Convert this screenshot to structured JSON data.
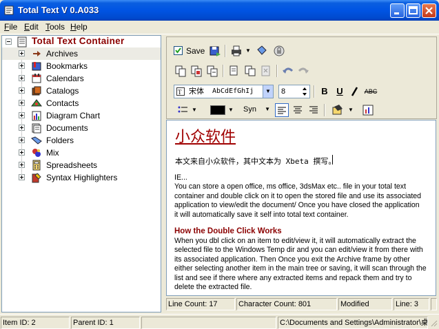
{
  "window": {
    "title": "Total Text V 0.A033"
  },
  "menu": [
    "File",
    "Edit",
    "Tools",
    "Help"
  ],
  "tree": {
    "root": "Total Text Container",
    "items": [
      {
        "label": "Archives",
        "icon": "arrow-icon"
      },
      {
        "label": "Bookmarks",
        "icon": "bookmarks-icon"
      },
      {
        "label": "Calendars",
        "icon": "calendar-icon"
      },
      {
        "label": "Catalogs",
        "icon": "catalog-icon"
      },
      {
        "label": "Contacts",
        "icon": "contacts-icon"
      },
      {
        "label": "Diagram Chart",
        "icon": "chart-icon"
      },
      {
        "label": "Documents",
        "icon": "documents-icon"
      },
      {
        "label": "Folders",
        "icon": "folder-icon"
      },
      {
        "label": "Mix",
        "icon": "mix-icon"
      },
      {
        "label": "Spreadsheets",
        "icon": "spreadsheet-icon"
      },
      {
        "label": "Syntax Highlighters",
        "icon": "syntax-icon"
      }
    ]
  },
  "toolbar": {
    "save_label": "Save",
    "save_checked": true
  },
  "format": {
    "font_name": "宋体",
    "font_preview": "AbCdEfGhIj",
    "font_size": "8",
    "syn_label": "Syn"
  },
  "editor": {
    "cn_title": "小众软件",
    "cn_line": "本文来自小众软件，其中文本为 Xbeta 撰写。",
    "para1_lines": [
      "IE...",
      "You can store a open office, ms office, 3dsMax etc.. file in your total text",
      "container and double click on it to open the stored file and use its associated",
      "application to view/edit the document/ Once you have closed the application",
      "it will automatically save it self into total text container."
    ],
    "heading": "How the Double Click Works",
    "para2_lines": [
      "When you dbl click on an item to edit/view it, it will automatically extract the",
      "selected file to the Windows Temp dir and you can edit/view it from there with",
      "its associated application. Then Once you exit the Archive frame by other",
      "either selecting another item in the main tree or saving, it will scan through the",
      "list and see if there where any extracted items and repack them and try to",
      "delete the extracted file."
    ]
  },
  "editor_status": {
    "line_count": "Line Count: 17",
    "char_count": "Character Count: 801",
    "modified": "Modified",
    "line": "Line: 3"
  },
  "status": {
    "item_id": "Item ID: 2",
    "parent_id": "Parent ID: 1",
    "path": "C:\\Documents and Settings\\Administrator\\桌"
  },
  "colors": {
    "title_bar": "#0054e3",
    "accent_red": "#a00000",
    "heading": "#8b0000"
  }
}
